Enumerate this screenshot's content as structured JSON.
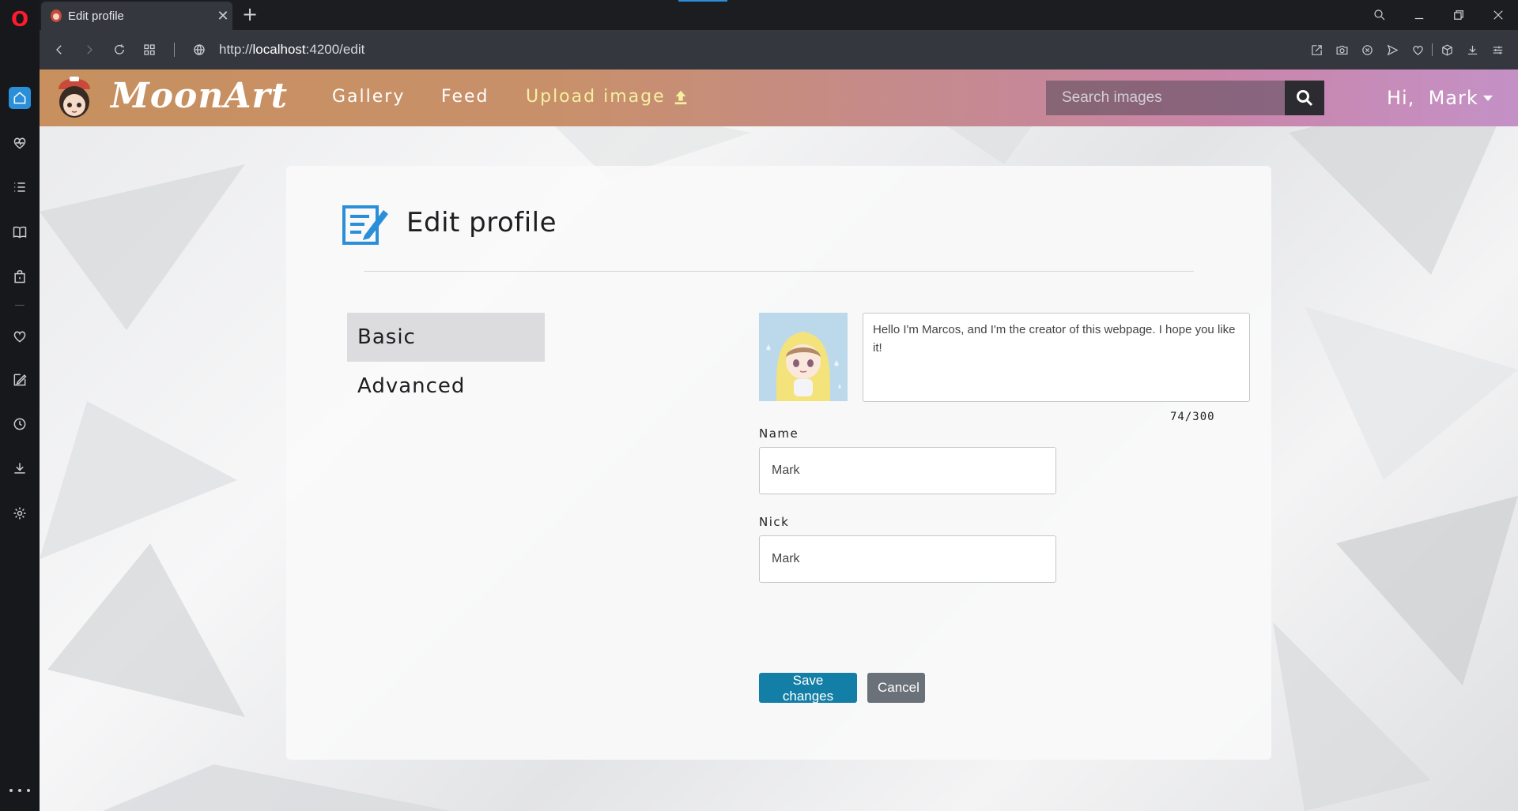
{
  "browser": {
    "tab_title": "Edit profile",
    "tab_close": "✕",
    "new_tab": "+",
    "url_prefix": "http://",
    "url_host": "localhost",
    "url_path": ":4200/edit",
    "sidebar_more": "..."
  },
  "nav": {
    "brand": "MoonArt",
    "links": [
      "Gallery",
      "Feed"
    ],
    "upload_label": "Upload image",
    "search_placeholder": "Search images",
    "user_greeting": "Hi,  Mark"
  },
  "page": {
    "title": "Edit profile",
    "menu": [
      "Basic",
      "Advanced"
    ],
    "bio_text": "Hello I'm Marcos, and I'm the creator of this webpage. I hope you like it!",
    "char_count": "74/300",
    "name_label": "Name",
    "name_value": "Mark",
    "nick_label": "Nick",
    "nick_value": "Mark",
    "save_label": "Save changes",
    "cancel_label": "Cancel"
  },
  "colors": {
    "accent": "#2a8fd8",
    "save": "#137fa6",
    "cancel": "#6b7178",
    "upload": "#f5f0a0"
  }
}
